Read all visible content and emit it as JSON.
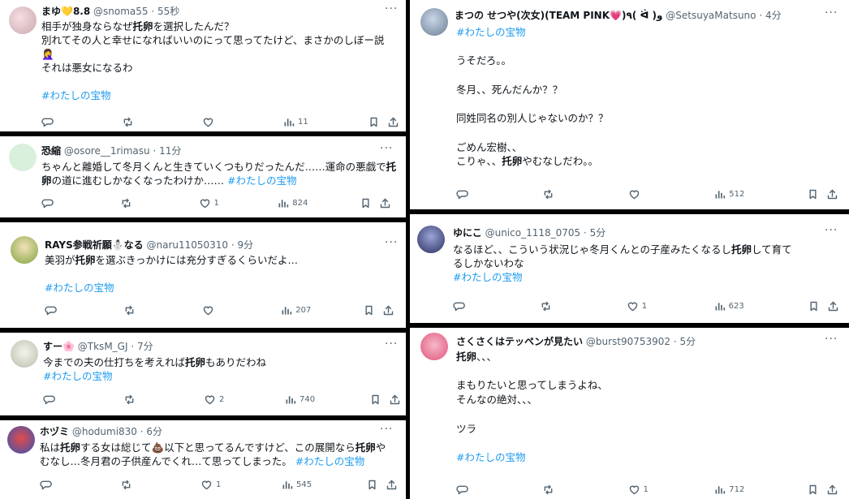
{
  "colors": {
    "name": "#0f1419",
    "muted": "#536471",
    "hashtag": "#1d9bf0",
    "background": "#000000",
    "card": "#ffffff"
  },
  "tweets": [
    {
      "name": "まゆ💛8.8",
      "handle": "@snoma55",
      "time": "55秒",
      "lines": [
        [
          "相手が独身ならなぜ",
          "*托卵",
          "を選択したんだ？"
        ],
        [
          "別れてその人と幸せになればいいのにって思ってたけど、まさかのしぼー説"
        ],
        [
          "🤦‍♀️"
        ],
        [
          "それは悪女になるわ"
        ],
        [
          ""
        ],
        [
          "#わたしの宝物"
        ]
      ],
      "stats": {
        "reply": "",
        "retweet": "",
        "like": "",
        "views": "11"
      }
    },
    {
      "name": "恐縮",
      "handle": "@osore__1rimasu",
      "time": "11分",
      "lines": [
        [
          "ちゃんと離婚して冬月くんと生きていくつもりだったんだ……運命の悪戯で",
          "*托"
        ],
        [
          "*卵",
          "の道に進むしかなくなったわけか…… ",
          "#わたしの宝物"
        ]
      ],
      "stats": {
        "reply": "",
        "retweet": "",
        "like": "1",
        "views": "824"
      }
    },
    {
      "name": "RAYS参戦祈願⛄なる",
      "handle": "@naru11050310",
      "time": "9分",
      "lines": [
        [
          "美羽が",
          "*托卵",
          "を選ぶきっかけには充分すぎるくらいだよ…"
        ],
        [
          ""
        ],
        [
          "#わたしの宝物"
        ]
      ],
      "stats": {
        "reply": "",
        "retweet": "",
        "like": "",
        "views": "207"
      }
    },
    {
      "name": "すー🌸",
      "handle": "@TksM_GJ",
      "time": "7分",
      "lines": [
        [
          "今までの夫の仕打ちを考えれば",
          "*托卵",
          "もありだわね"
        ],
        [
          "#わたしの宝物"
        ]
      ],
      "stats": {
        "reply": "",
        "retweet": "",
        "like": "2",
        "views": "740"
      }
    },
    {
      "name": "ホヅミ",
      "handle": "@hodumi830",
      "time": "6分",
      "lines": [
        [
          "私は",
          "*托卵",
          "する女は総じて💩以下と思ってるんですけど、この展開なら",
          "*托卵",
          "や"
        ],
        [
          "むなし…冬月君の子供産んでくれ…て思ってしまった。 ",
          "#わたしの宝物"
        ]
      ],
      "stats": {
        "reply": "",
        "retweet": "",
        "like": "1",
        "views": "545"
      }
    },
    {
      "name": "まつの せつや(次女)(TEAM PINK💗)٩( ᐛ )و",
      "handle": "@SetsuyaMatsuno",
      "time": "4分",
      "lines": [
        [
          "#わたしの宝物"
        ],
        [
          ""
        ],
        [
          "うそだろ。。"
        ],
        [
          ""
        ],
        [
          "冬月、、死んだんか？？"
        ],
        [
          ""
        ],
        [
          "同姓同名の別人じゃないのか？？"
        ],
        [
          ""
        ],
        [
          "ごめん宏樹、、"
        ],
        [
          "こりゃ、、",
          "*托卵",
          "やむなしだわ。。"
        ]
      ],
      "stats": {
        "reply": "",
        "retweet": "",
        "like": "",
        "views": "512"
      }
    },
    {
      "name": "ゆにこ",
      "handle": "@unico_1118_0705",
      "time": "5分",
      "lines": [
        [
          "なるほど、、こういう状況じゃ冬月くんとの子産みたくなるし",
          "*托卵",
          "して育て"
        ],
        [
          "るしかないわな"
        ],
        [
          "#わたしの宝物"
        ]
      ],
      "stats": {
        "reply": "",
        "retweet": "",
        "like": "1",
        "views": "623"
      }
    },
    {
      "name": "さくさくはテッペンが見たい",
      "handle": "@burst90753902",
      "time": "5分",
      "lines": [
        [
          "*托卵",
          "、、、"
        ],
        [
          ""
        ],
        [
          "まもりたいと思ってしまうよね、"
        ],
        [
          "そんなの絶対、、、"
        ],
        [
          ""
        ],
        [
          "ツラ"
        ],
        [
          ""
        ],
        [
          "#わたしの宝物"
        ]
      ],
      "stats": {
        "reply": "",
        "retweet": "",
        "like": "1",
        "views": "712"
      }
    }
  ]
}
